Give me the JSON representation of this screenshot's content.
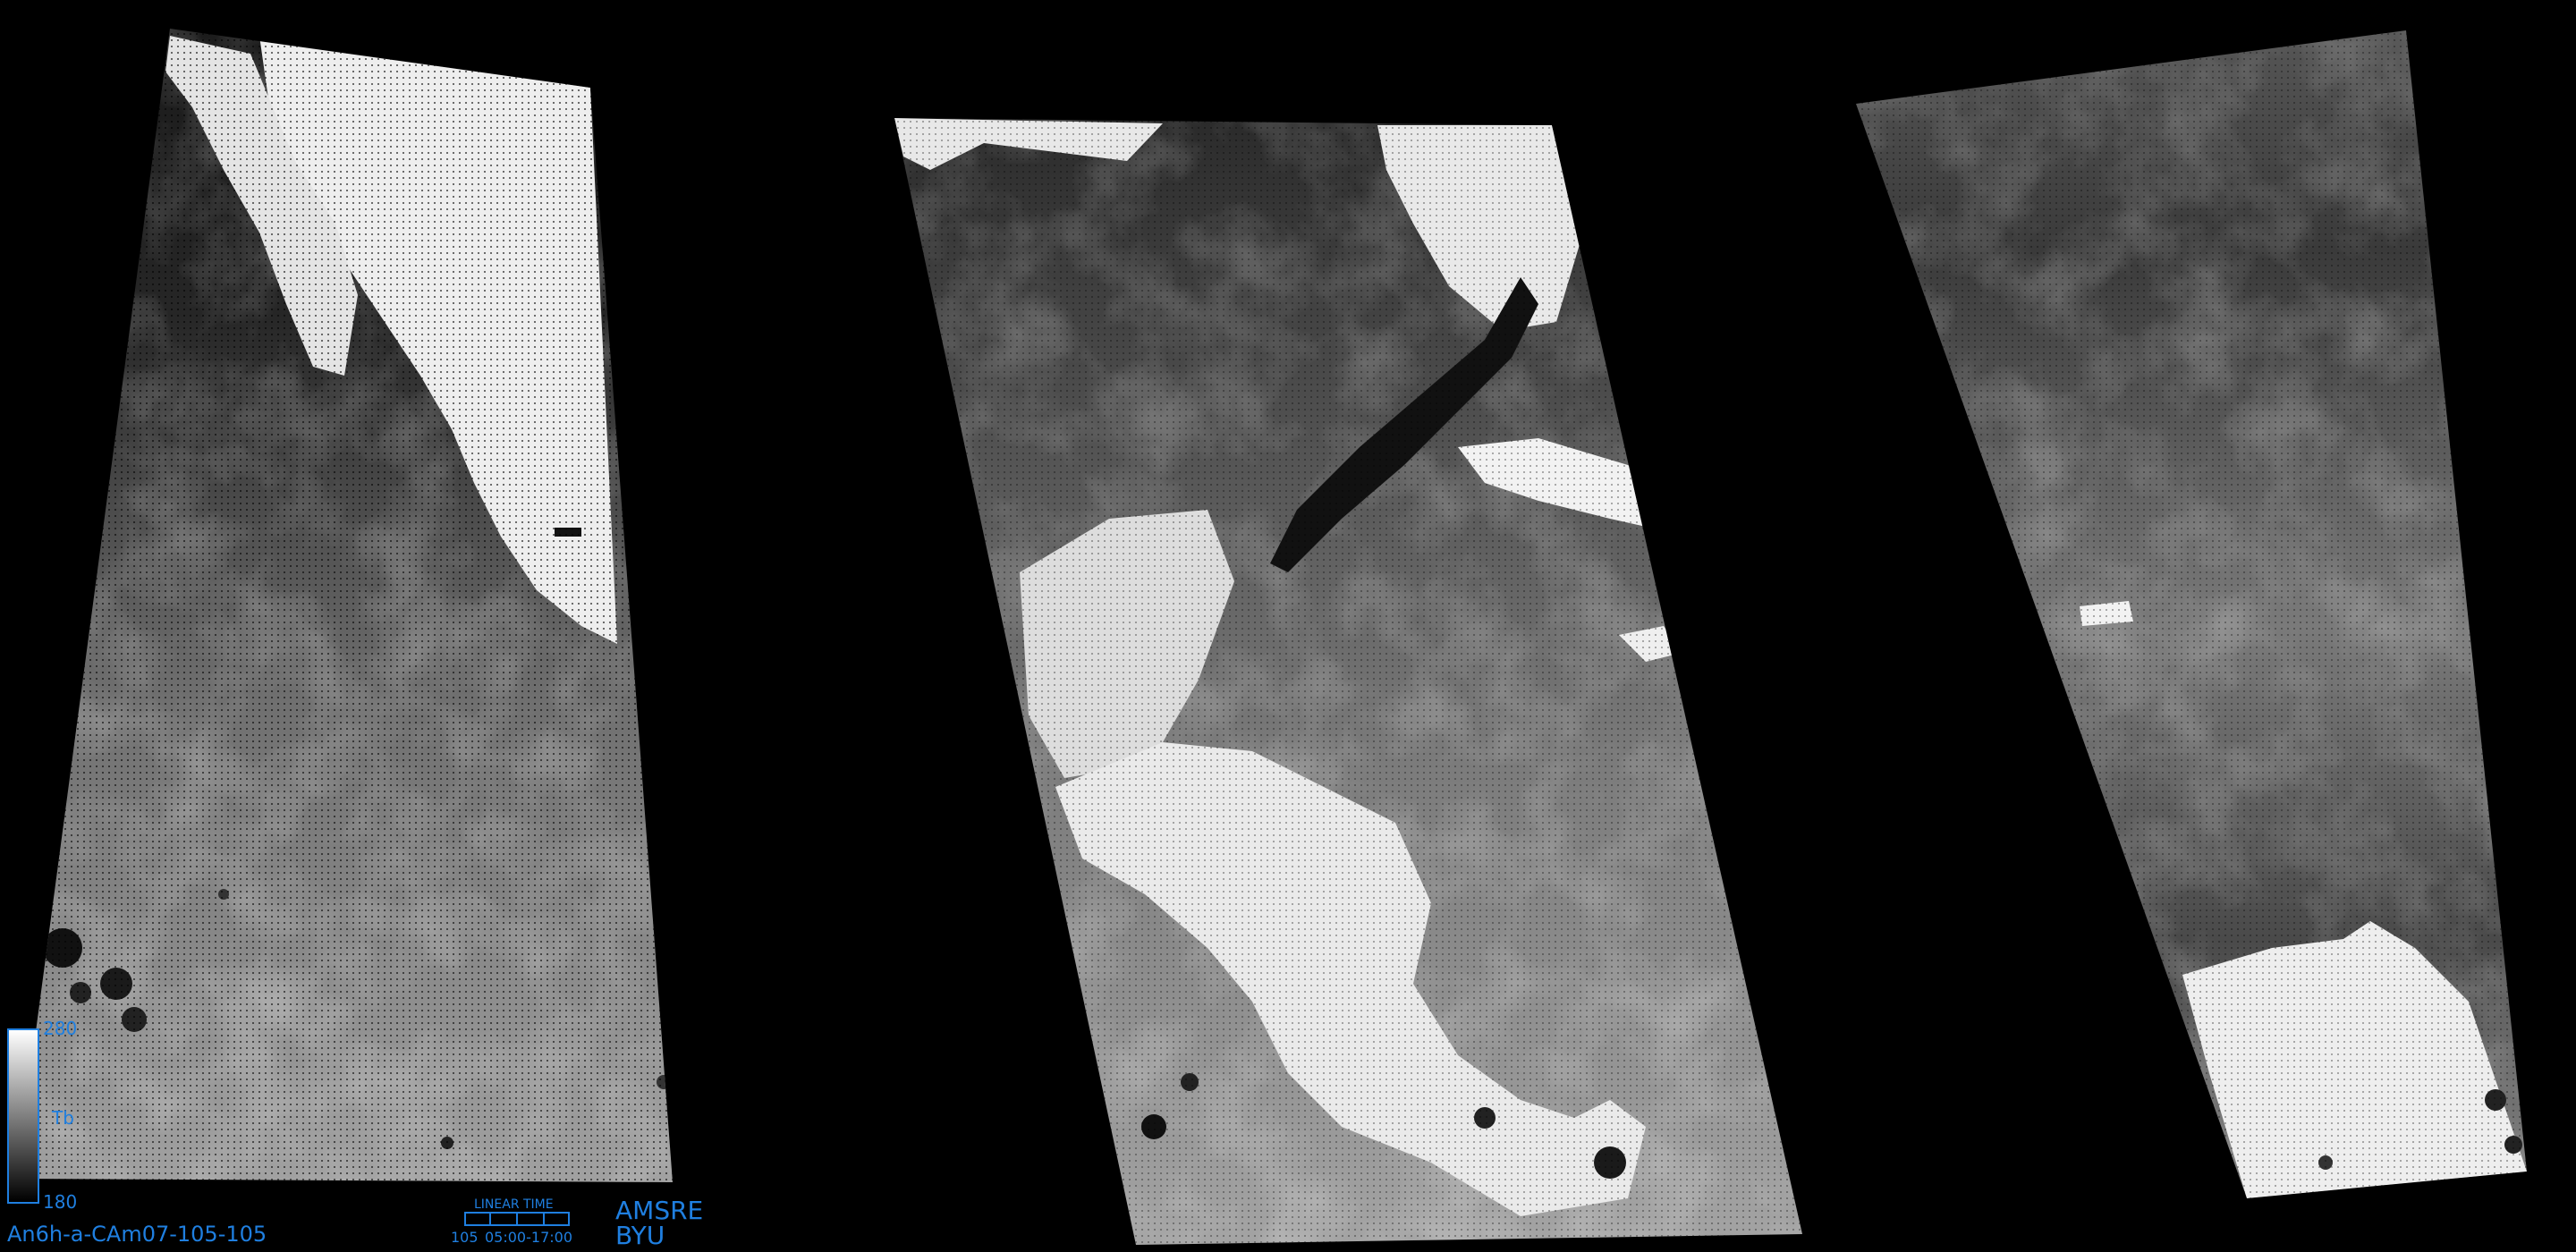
{
  "image": {
    "sensor": "AMSRE",
    "institution": "BYU",
    "filename": "An6h-a-CAm07-105-105",
    "colorbar": {
      "max_label": "280",
      "min_label": "180",
      "quantity_label": "Tb",
      "low_color": "#000000",
      "high_color": "#ffffff"
    },
    "time_legend": {
      "title": "LINEAR TIME",
      "day_label": "105",
      "range_label": "05:00-17:00"
    },
    "label_color": "#1f7fe0",
    "background_color": "#000000"
  }
}
